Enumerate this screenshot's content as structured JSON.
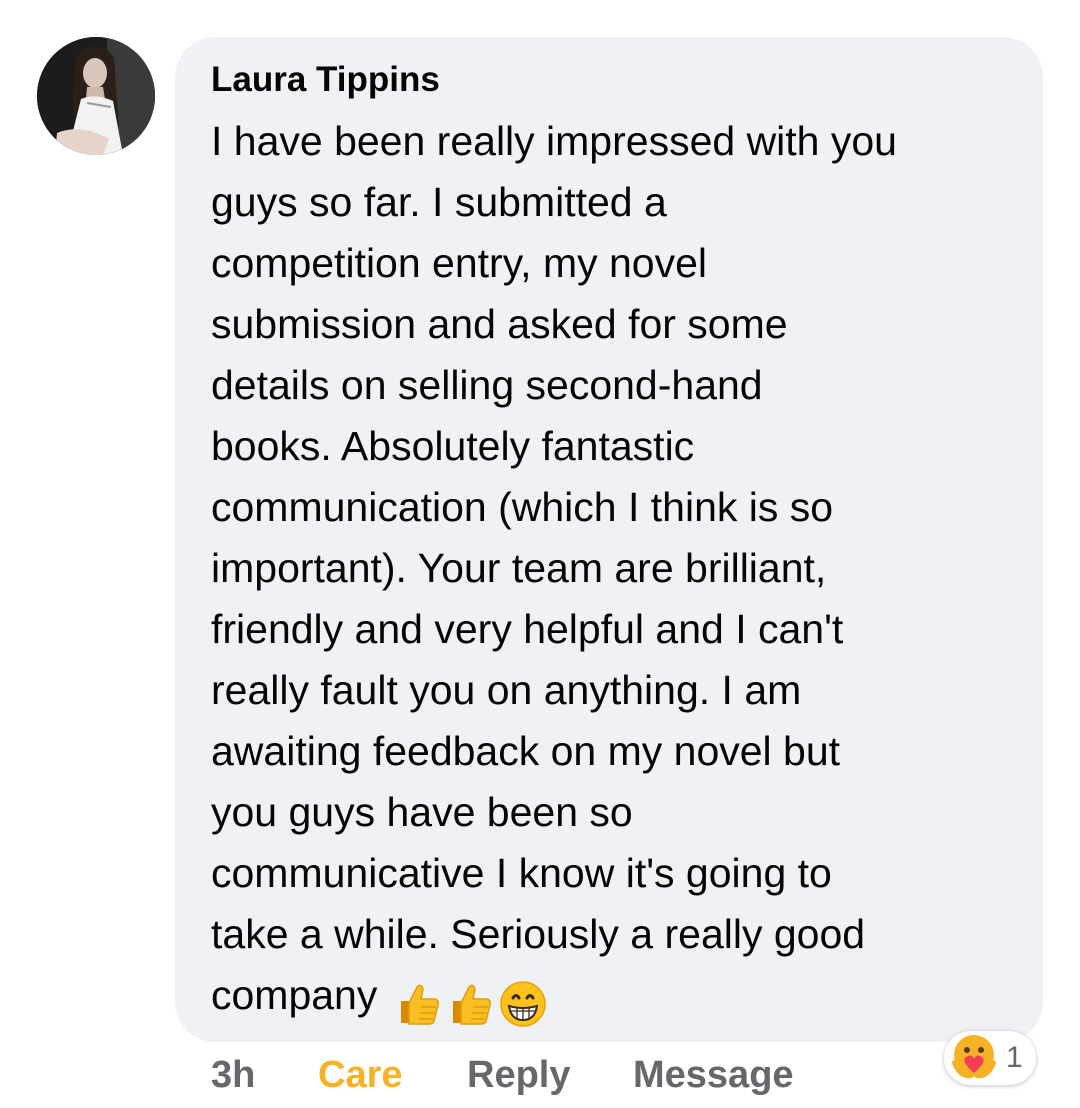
{
  "comment": {
    "author": "Laura Tippins",
    "lines": [
      "I have been really impressed with you",
      "guys so far. I submitted a",
      "competition entry, my novel",
      "submission and asked for some",
      "details on selling second-hand",
      "books. Absolutely fantastic",
      "communication (which I think is so",
      "important). Your team are brilliant,",
      "friendly and very helpful and I can't",
      "really fault you on anything. I am",
      "awaiting feedback on my novel but",
      "you guys have been so",
      "communicative I know it's going to",
      "take a while. Seriously a really good",
      "company"
    ],
    "trailing_emojis": [
      "thumbs-up-icon",
      "thumbs-up-icon",
      "grinning-face-icon"
    ]
  },
  "actions": {
    "time": "3h",
    "care": "Care",
    "reply": "Reply",
    "message": "Message"
  },
  "reactions": {
    "icon": "care-reaction-icon",
    "count": "1"
  },
  "colors": {
    "bubble_bg": "#eff1f5",
    "text": "#050505",
    "secondary": "#65676b",
    "care_accent": "#f7b125"
  }
}
